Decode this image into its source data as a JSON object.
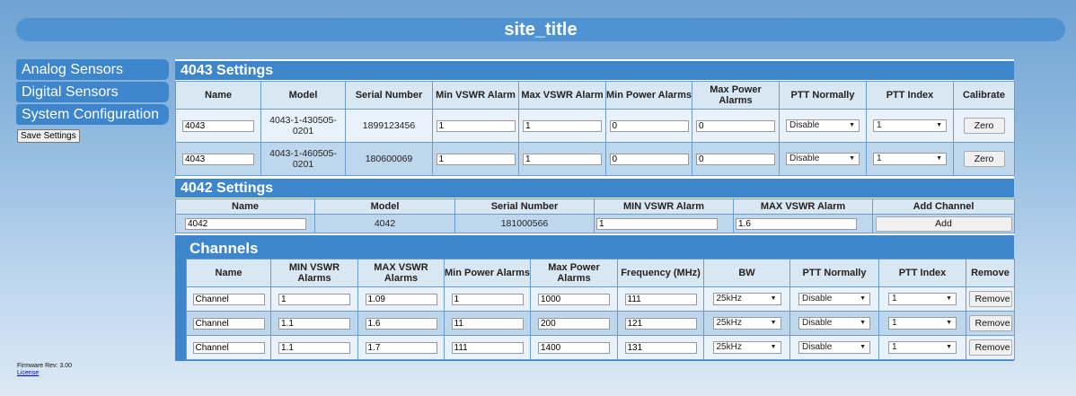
{
  "site_title": "site_title",
  "nav": {
    "items": [
      "Analog Sensors",
      "Digital Sensors",
      "System Configuration"
    ]
  },
  "save_settings_label": "Save Settings",
  "firmware": {
    "rev": "Firmware Rev: 3.00",
    "license": "License"
  },
  "s4043": {
    "title": "4043 Settings",
    "headers": [
      "Name",
      "Model",
      "Serial Number",
      "Min VSWR Alarm",
      "Max VSWR Alarm",
      "Min Power Alarms",
      "Max Power Alarms",
      "PTT Normally",
      "PTT Index",
      "Calibrate"
    ],
    "rows": [
      {
        "name": "4043",
        "model": "4043-1-430505-0201",
        "serial": "1899123456",
        "min_vswr": "1",
        "max_vswr": "1",
        "min_power": "0",
        "max_power": "0",
        "ptt_normally": "Disable",
        "ptt_index": "1",
        "calibrate": "Zero"
      },
      {
        "name": "4043",
        "model": "4043-1-460505-0201",
        "serial": "180600069",
        "min_vswr": "1",
        "max_vswr": "1",
        "min_power": "0",
        "max_power": "0",
        "ptt_normally": "Disable",
        "ptt_index": "1",
        "calibrate": "Zero"
      }
    ]
  },
  "s4042": {
    "title": "4042 Settings",
    "headers": [
      "Name",
      "Model",
      "Serial Number",
      "MIN VSWR Alarm",
      "MAX VSWR Alarm",
      "Add Channel"
    ],
    "row": {
      "name": "4042",
      "model": "4042",
      "serial": "181000566",
      "min_vswr": "1",
      "max_vswr": "1.6",
      "add": "Add"
    }
  },
  "channels": {
    "title": "Channels",
    "headers": [
      "Name",
      "MIN VSWR Alarms",
      "MAX VSWR Alarms",
      "Min Power Alarms",
      "Max Power Alarms",
      "Frequency (MHz)",
      "BW",
      "PTT Normally",
      "PTT Index",
      "Remove"
    ],
    "rows": [
      {
        "name": "Channel",
        "min_vswr": "1",
        "max_vswr": "1.09",
        "min_power": "1",
        "max_power": "1000",
        "freq": "111",
        "bw": "25kHz",
        "ptt_normally": "Disable",
        "ptt_index": "1",
        "remove": "Remove"
      },
      {
        "name": "Channel",
        "min_vswr": "1.1",
        "max_vswr": "1.6",
        "min_power": "11",
        "max_power": "200",
        "freq": "121",
        "bw": "25kHz",
        "ptt_normally": "Disable",
        "ptt_index": "1",
        "remove": "Remove"
      },
      {
        "name": "Channel",
        "min_vswr": "1.1",
        "max_vswr": "1.7",
        "min_power": "111",
        "max_power": "1400",
        "freq": "131",
        "bw": "25kHz",
        "ptt_normally": "Disable",
        "ptt_index": "1",
        "remove": "Remove"
      }
    ]
  }
}
